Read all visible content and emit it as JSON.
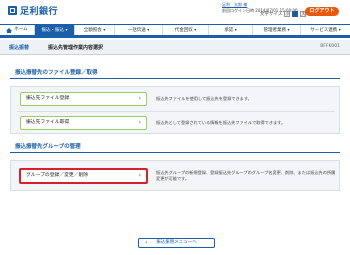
{
  "header": {
    "bank_name": "足利銀行",
    "user_line": "足利　太郎 様",
    "last_login": "前回ログイン日時 2014/07/01 15:00:00",
    "text_size_label": "文字サイズ",
    "text_size_options": [
      "小",
      "中",
      "大"
    ],
    "logout_label": "ログアウト"
  },
  "nav": {
    "home_label": "ホーム",
    "items": [
      "振込・振込",
      "全額照会",
      "一括伝送",
      "代金回収",
      "承認",
      "管理者業務",
      "サービス連携"
    ]
  },
  "title_bar": {
    "section": "振込振替",
    "title": "振込先管理作業内容選択",
    "screen_code": "BFFK001"
  },
  "sections": [
    {
      "title": "振込振替先のファイル登録／取得",
      "rows": [
        {
          "button": "振込先ファイル登録",
          "description": "振込先ファイルを使用して振込先を登録できます。"
        },
        {
          "button": "振込先ファイル取得",
          "description": "振込先として登録されている情報を振込先ファイルで取得できます。"
        }
      ]
    },
    {
      "title": "振込振替先グループの管理",
      "rows": [
        {
          "button": "グループの登録／変更／削除",
          "description": "振込先グループの新規登録、登録振込先グループのグループ名変更、削除、または振込先の所属変更が可能です。"
        }
      ]
    }
  ],
  "back_button": "振込振替メニューへ",
  "colors": {
    "brand": "#1a5fa8",
    "logout": "#e8590c",
    "button_border": "#9ccc65",
    "highlight": "#d6202a"
  },
  "icons": {
    "home": "home-icon",
    "chevron": "chevron-right-icon",
    "back": "chevron-left-icon"
  }
}
